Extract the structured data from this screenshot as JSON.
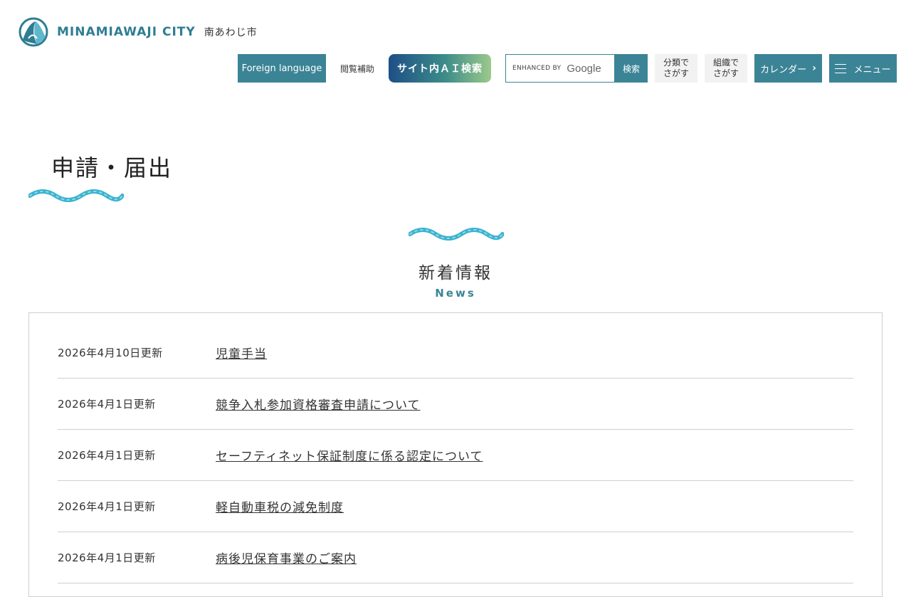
{
  "header": {
    "logo_en": "MINAMIAWAJI CITY",
    "logo_ja": "南あわじ市",
    "foreign_language": "Foreign language",
    "accessibility": "閲覧補助",
    "ai_search": "サイト内ＡＩ検索",
    "search_enhanced_by": "ENHANCED BY",
    "search_google": "Google",
    "search_button": "検索",
    "category_search_line1": "分類で",
    "category_search_line2": "さがす",
    "org_search_line1": "組織で",
    "org_search_line2": "さがす",
    "calendar": "カレンダー",
    "menu": "メニュー"
  },
  "page": {
    "title": "申請・届出"
  },
  "news": {
    "title": "新着情報",
    "subtitle": "News",
    "items": [
      {
        "date": "2026年4月10日更新",
        "title": "児童手当"
      },
      {
        "date": "2026年4月1日更新",
        "title": "競争入札参加資格審査申請について"
      },
      {
        "date": "2026年4月1日更新",
        "title": "セーフティネット保証制度に係る認定について"
      },
      {
        "date": "2026年4月1日更新",
        "title": "軽自動車税の減免制度"
      },
      {
        "date": "2026年4月1日更新",
        "title": "病後児保育事業のご案内"
      }
    ]
  },
  "colors": {
    "accent": "#3b8496",
    "wave": "#39b2cf"
  },
  "icons": [
    "city-logo-icon",
    "chevron-right-icon",
    "hamburger-menu-icon",
    "wave-decoration-icon"
  ]
}
